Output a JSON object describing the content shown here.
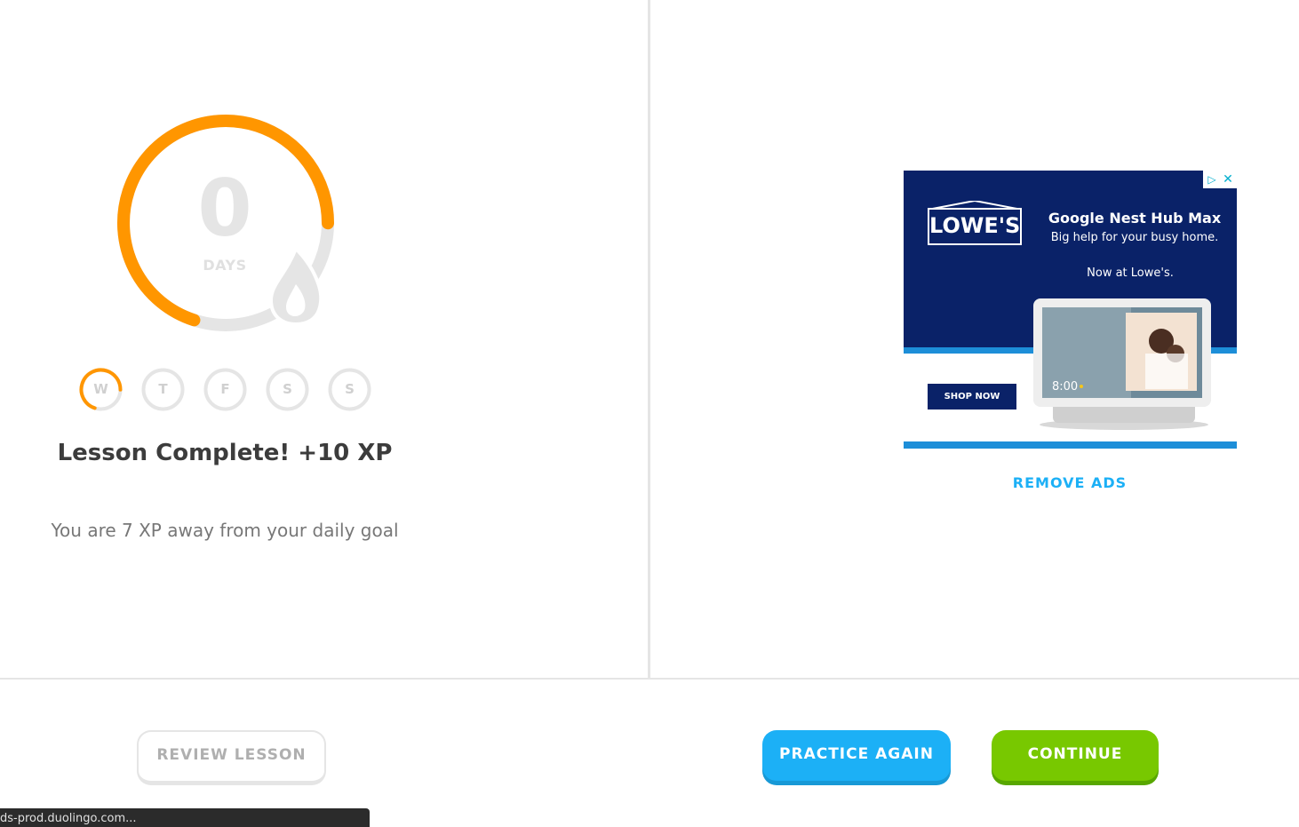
{
  "streak": {
    "count": "0",
    "unit": "DAYS",
    "ring_progress": 0.7,
    "colors": {
      "progress": "#ff9600",
      "track": "#e5e5e5"
    }
  },
  "week": {
    "days": [
      "W",
      "T",
      "F",
      "S",
      "S"
    ],
    "active_index": 0,
    "active_progress": 0.7
  },
  "lesson": {
    "title": "Lesson Complete! +10 XP",
    "goal_text": "You are 7 XP away from your daily goal"
  },
  "ad": {
    "brand": "LOWE'S",
    "title": "Google Nest Hub Max",
    "subtitle": "Big help for your busy home.",
    "tagline": "Now at Lowe's.",
    "cta": "SHOP NOW",
    "device_time": "8:00",
    "remove_ads_label": "REMOVE ADS"
  },
  "buttons": {
    "review": "REVIEW LESSON",
    "practice": "PRACTICE AGAIN",
    "continue": "CONTINUE"
  },
  "status_bar": {
    "url": "ds-prod.duolingo.com..."
  },
  "colors": {
    "blue": "#1cb0f6",
    "green": "#78c800",
    "orange": "#ff9600",
    "ad_navy": "#0a2268"
  }
}
